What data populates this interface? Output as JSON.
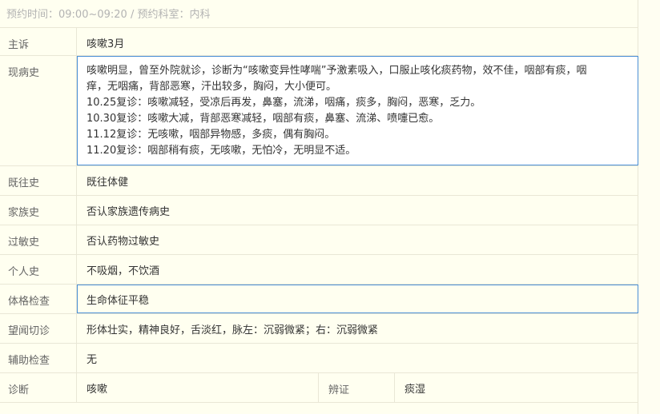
{
  "appointment": {
    "text": "预约时间：09:00~09:20 / 预约科室：内科"
  },
  "fields": {
    "chief_complaint": {
      "label": "主诉",
      "value": "咳嗽3月"
    },
    "present_illness": {
      "label": "现病史",
      "lines": [
        "咳嗽明显，曾至外院就诊，诊断为“咳嗽变异性哮喘”予激素吸入，口服止咳化痰药物，效不佳，咽部有痰，咽",
        "痒，无咽痛，背部恶寒，汗出较多，胸闷，大小便可。",
        "10.25复诊：咳嗽减轻，受凉后再发，鼻塞，流涕，咽痛，痰多，胸闷，恶寒，乏力。",
        "10.30复诊：咳嗽大减，背部恶寒减轻，咽部有痰，鼻塞、流涕、喷嚏已愈。",
        "11.12复诊：无咳嗽，咽部异物感，多痰，偶有胸闷。",
        "11.20复诊：咽部稍有痰，无咳嗽，无怕冷，无明显不适。"
      ]
    },
    "past_history": {
      "label": "既往史",
      "value": "既往体健"
    },
    "family_history": {
      "label": "家族史",
      "value": "否认家族遗传病史"
    },
    "allergy_history": {
      "label": "过敏史",
      "value": "否认药物过敏史"
    },
    "personal_history": {
      "label": "个人史",
      "value": "不吸烟，不饮酒"
    },
    "physical_exam": {
      "label": "体格检查",
      "value": "生命体征平稳"
    },
    "tcm_exam": {
      "label": "望闻切诊",
      "value": "形体壮实，精神良好，舌淡红，脉左：沉弱微紧；右：沉弱微紧"
    },
    "auxiliary_exam": {
      "label": "辅助检查",
      "value": "无"
    },
    "diagnosis": {
      "label": "诊断",
      "value": "咳嗽",
      "syndrome_label": "辨证",
      "syndrome_value": "痰湿"
    }
  }
}
